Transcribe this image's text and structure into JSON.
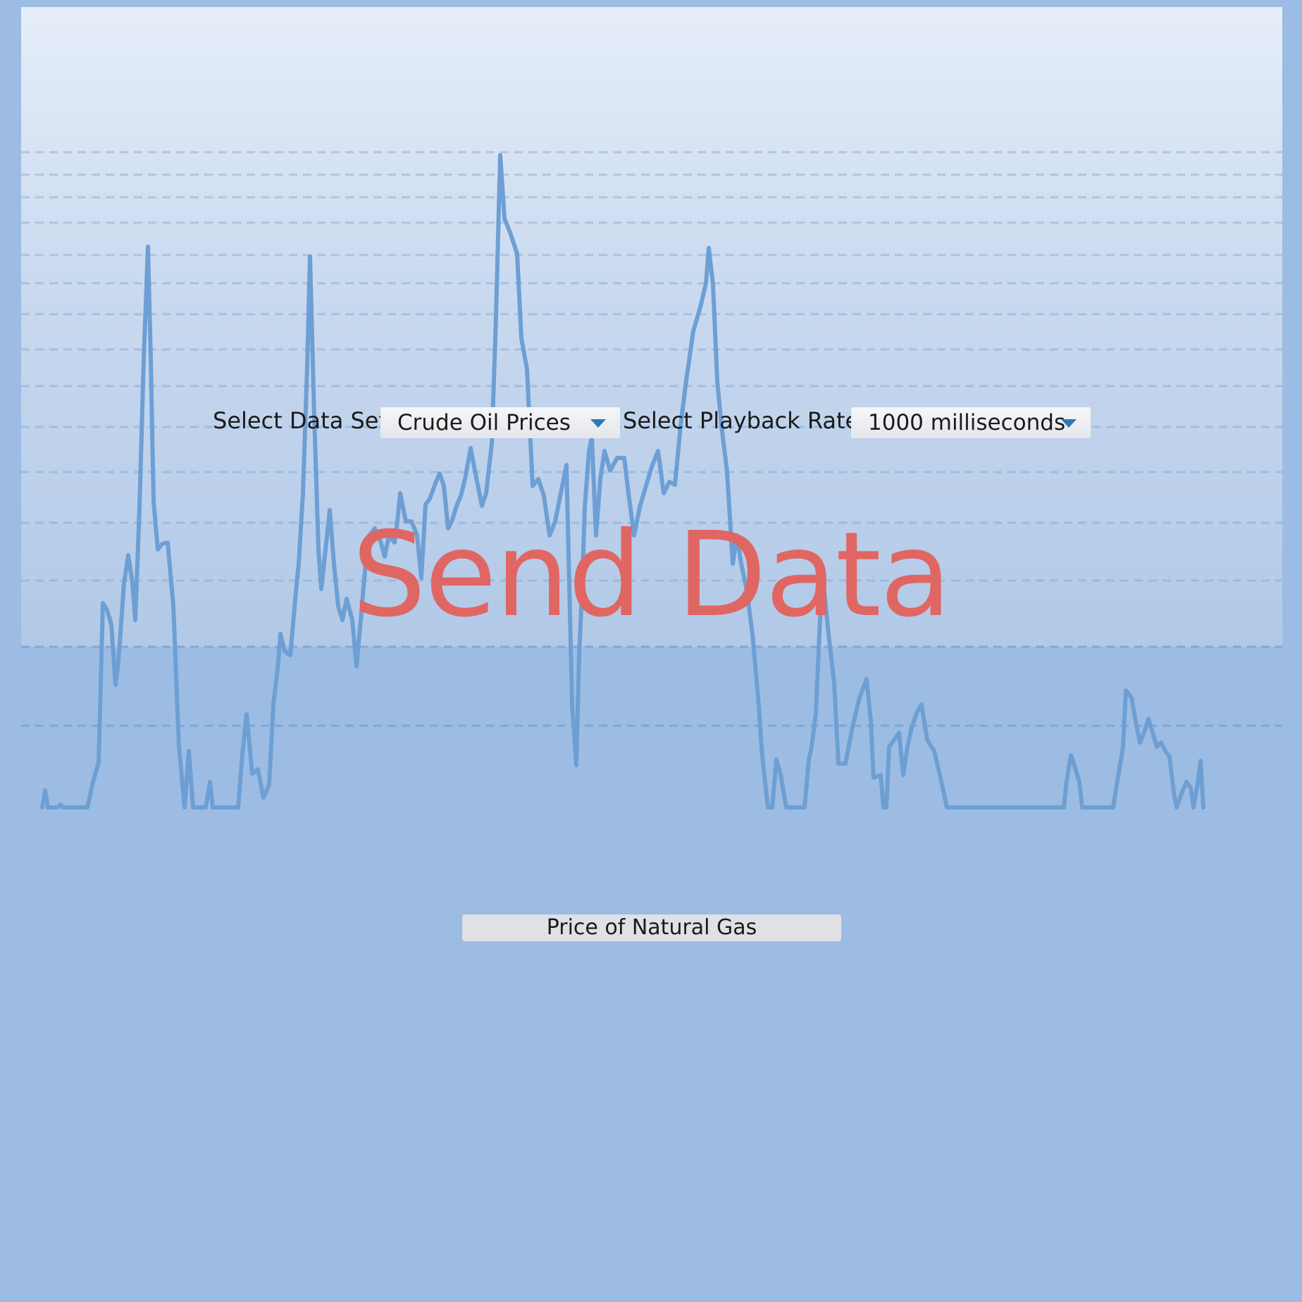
{
  "controls": {
    "data_set_label": "Select Data Set:",
    "data_set_selected": "Crude Oil Prices",
    "playback_label": "Select Playback Rate:",
    "playback_selected": "1000 milliseconds"
  },
  "send_button": {
    "label": "Send Data"
  },
  "series_button": {
    "label": "Price of Natural Gas"
  },
  "colors": {
    "page_background": "#9dbce4",
    "send_data_text": "#e06663",
    "series_line": "#6d9fd4",
    "gridline": "#7aa5d6",
    "caret": "#2f78b5"
  },
  "icons": [
    "chevron-down-icon",
    "chevron-down-icon"
  ]
}
